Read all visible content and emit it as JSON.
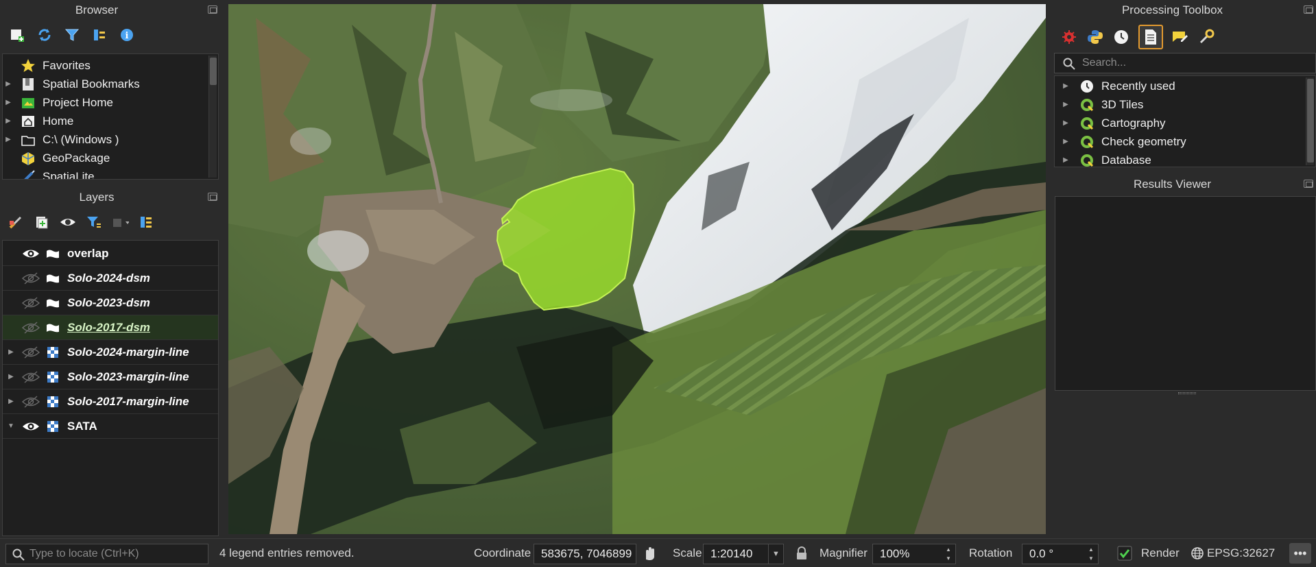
{
  "browser": {
    "title": "Browser",
    "items": [
      {
        "label": "Favorites",
        "icon": "star-icon",
        "expandable": false
      },
      {
        "label": "Spatial Bookmarks",
        "icon": "bookmark-icon",
        "expandable": true
      },
      {
        "label": "Project Home",
        "icon": "project-home-icon",
        "expandable": true
      },
      {
        "label": "Home",
        "icon": "home-icon",
        "expandable": true
      },
      {
        "label": "C:\\ (Windows )",
        "icon": "folder-icon",
        "expandable": true
      },
      {
        "label": "GeoPackage",
        "icon": "geopackage-icon",
        "expandable": false
      },
      {
        "label": "SpatiaLite",
        "icon": "spatialite-icon",
        "expandable": false
      }
    ]
  },
  "layers": {
    "title": "Layers",
    "items": [
      {
        "label": "overlap",
        "visible": true,
        "type": "polygon",
        "italic": false,
        "selected": false,
        "expandable": false
      },
      {
        "label": "Solo-2024-dsm",
        "visible": false,
        "type": "polygon",
        "italic": true,
        "selected": false,
        "expandable": false
      },
      {
        "label": "Solo-2023-dsm",
        "visible": false,
        "type": "polygon",
        "italic": true,
        "selected": false,
        "expandable": false
      },
      {
        "label": "Solo-2017-dsm",
        "visible": false,
        "type": "polygon",
        "italic": true,
        "selected": true,
        "expandable": false
      },
      {
        "label": "Solo-2024-margin-line",
        "visible": false,
        "type": "raster",
        "italic": true,
        "selected": false,
        "expandable": true
      },
      {
        "label": "Solo-2023-margin-line",
        "visible": false,
        "type": "raster",
        "italic": true,
        "selected": false,
        "expandable": true
      },
      {
        "label": "Solo-2017-margin-line",
        "visible": false,
        "type": "raster",
        "italic": true,
        "selected": false,
        "expandable": true
      },
      {
        "label": "SATA",
        "visible": true,
        "type": "raster",
        "italic": false,
        "selected": false,
        "expandable": true,
        "expanded": true
      }
    ]
  },
  "toolbox": {
    "title": "Processing Toolbox",
    "search_placeholder": "Search...",
    "items": [
      {
        "label": "Recently used",
        "icon": "clock-icon"
      },
      {
        "label": "3D Tiles",
        "icon": "qgis-icon"
      },
      {
        "label": "Cartography",
        "icon": "qgis-icon"
      },
      {
        "label": "Check geometry",
        "icon": "qgis-icon"
      },
      {
        "label": "Database",
        "icon": "qgis-icon"
      }
    ]
  },
  "results": {
    "title": "Results Viewer"
  },
  "status": {
    "locator_placeholder": "Type to locate (Ctrl+K)",
    "message": "4 legend entries removed.",
    "coordinate_label": "Coordinate",
    "coordinate_value": "583675, 7046899",
    "scale_label": "Scale",
    "scale_value": "1:20140",
    "magnifier_label": "Magnifier",
    "magnifier_value": "100%",
    "rotation_label": "Rotation",
    "rotation_value": "0.0 °",
    "render_label": "Render",
    "render_checked": true,
    "crs": "EPSG:32627"
  },
  "colors": {
    "overlap_fill": "#9bde2c",
    "overlap_stroke": "#c4f255",
    "accent": "#e39a2f"
  }
}
